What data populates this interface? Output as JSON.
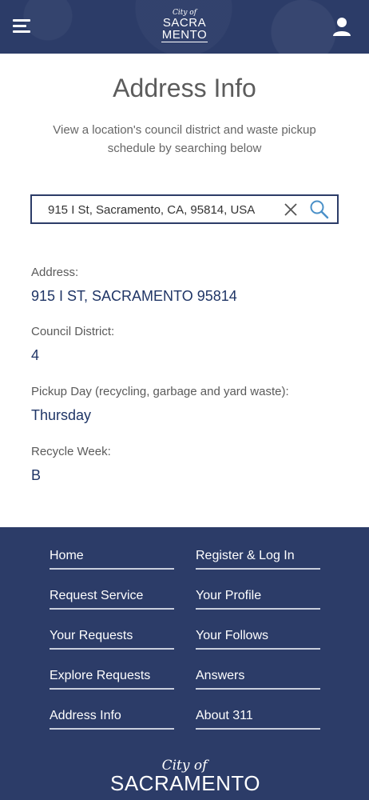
{
  "header": {
    "logo_small": "City of",
    "logo_line1": "SACRA",
    "logo_line2": "MENTO"
  },
  "main": {
    "title": "Address Info",
    "subtitle": "View a location's council district and waste pickup schedule by searching below"
  },
  "search": {
    "value": "915 I St, Sacramento, CA, 95814, USA"
  },
  "results": {
    "address_label": "Address:",
    "address_value": "915 I ST, SACRAMENTO 95814",
    "district_label": "Council District:",
    "district_value": "4",
    "pickup_label": "Pickup Day (recycling, garbage and yard waste):",
    "pickup_value": "Thursday",
    "recycle_label": "Recycle Week:",
    "recycle_value": "B"
  },
  "footer": {
    "links_left": [
      "Home",
      "Request Service",
      "Your Requests",
      "Explore Requests",
      "Address Info"
    ],
    "links_right": [
      "Register & Log In",
      "Your Profile",
      "Your Follows",
      "Answers",
      "About 311"
    ],
    "logo_small": "City of",
    "logo_big": "SACRAMENTO"
  },
  "colors": {
    "brand_navy": "#2c3c68",
    "value_text": "#1f3566",
    "search_icon": "#4a90c8"
  },
  "icons": {
    "menu": "hamburger-menu-icon",
    "user": "user-icon",
    "clear": "close-icon",
    "search": "search-icon"
  }
}
